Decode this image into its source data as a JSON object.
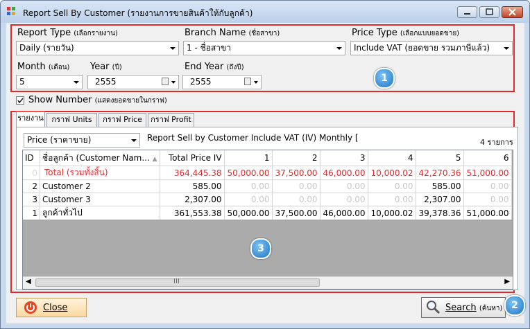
{
  "window": {
    "title": "Report Sell By Customer (รายงานการขายสินค้าให้กับลูกค้า)"
  },
  "filters": {
    "report_type": {
      "label": "Report Type",
      "label_th": "(เลือกรายงาน)",
      "value": "Daily (รายวัน)"
    },
    "branch_name": {
      "label": "Branch Name",
      "label_th": "(ชื่อสาขา)",
      "value": "1 - ชื่อสาขา"
    },
    "price_type": {
      "label": "Price Type",
      "label_th": "(เลือกแบบยอดขาย)",
      "value": "Include VAT (ยอดขาย รวมภาษีแล้ว)"
    },
    "month": {
      "label": "Month",
      "label_th": "(เดือน)",
      "value": "5"
    },
    "year": {
      "label": "Year",
      "label_th": "(ปี)",
      "value": "2555"
    },
    "end_year": {
      "label": "End Year",
      "label_th": "(ถึงปี)",
      "value": "2555"
    }
  },
  "show_number": {
    "label": "Show Number",
    "label_th": "(แสดงยอดขายในกราฟ)",
    "checked": true
  },
  "tabs": [
    "รายงาน",
    "กราฟ Units",
    "กราฟ Price",
    "กราฟ Profit"
  ],
  "report": {
    "price_combo": "Price (ราคาขาย)",
    "heading": "Report Sell by Customer Include VAT (IV) Monthly [",
    "count": "4 รายการ"
  },
  "table": {
    "columns": [
      "ID",
      "ชื่อลูกค้า  (Customer Nam...",
      "Total Price IV",
      "1",
      "2",
      "3",
      "4",
      "5",
      "6"
    ],
    "rows": [
      {
        "id": "0",
        "name": "Total (รวมทั้งสิ้น)",
        "total": "364,445.38",
        "m": [
          "50,000.00",
          "37,500.00",
          "46,000.00",
          "10,000.02",
          "42,270.36",
          "51,000.00"
        ]
      },
      {
        "id": "2",
        "name": "Customer 2",
        "total": "585.00",
        "m": [
          "0.00",
          "0.00",
          "0.00",
          "0.00",
          "585.00",
          "0.00"
        ]
      },
      {
        "id": "3",
        "name": "Customer 3",
        "total": "2,307.00",
        "m": [
          "0.00",
          "0.00",
          "0.00",
          "0.00",
          "2,307.00",
          "0.00"
        ]
      },
      {
        "id": "1",
        "name": "ลูกค้าทั่วไป",
        "total": "361,553.38",
        "m": [
          "50,000.00",
          "37,500.00",
          "46,000.00",
          "10,000.02",
          "39,378.36",
          "51,000.00"
        ]
      }
    ]
  },
  "buttons": {
    "close": "Close",
    "search": "Search",
    "search_th": "(ค้นหา)"
  },
  "badges": [
    "1",
    "2",
    "3"
  ],
  "colors": {
    "highlight": "#e0282d",
    "total_row": "#e0282d",
    "badge": "#2f8fdc"
  }
}
